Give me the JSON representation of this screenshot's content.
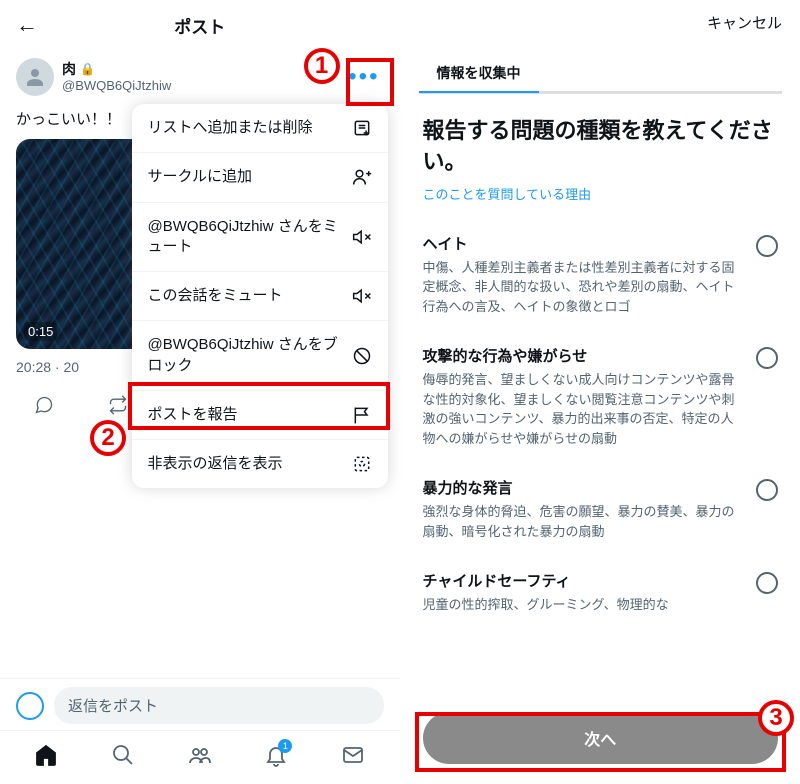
{
  "left": {
    "header_title": "ポスト",
    "user": {
      "name": "肉",
      "handle": "@BWQB6QiJtzhiw"
    },
    "post_text": "かっこいい！！",
    "duration": "0:15",
    "timestamp": "20:28 · 20",
    "reply_placeholder": "返信をポスト",
    "notif_badge": "1",
    "menu": [
      "リストへ追加または削除",
      "サークルに追加",
      "@BWQB6QiJtzhiw さんをミュート",
      "この会話をミュート",
      "@BWQB6QiJtzhiw さんをブロック",
      "ポストを報告",
      "非表示の返信を表示"
    ]
  },
  "right": {
    "cancel": "キャンセル",
    "step": "情報を収集中",
    "title": "報告する問題の種類を教えてください。",
    "reason_link": "このことを質問している理由",
    "next": "次へ",
    "options": [
      {
        "title": "ヘイト",
        "desc": "中傷、人種差別主義者または性差別主義者に対する固定概念、非人間的な扱い、恐れや差別の扇動、ヘイト行為への言及、ヘイトの象徴とロゴ"
      },
      {
        "title": "攻撃的な行為や嫌がらせ",
        "desc": "侮辱的発言、望ましくない成人向けコンテンツや露骨な性的対象化、望ましくない閲覧注意コンテンツや刺激の強いコンテンツ、暴力的出来事の否定、特定の人物への嫌がらせや嫌がらせの扇動"
      },
      {
        "title": "暴力的な発言",
        "desc": "強烈な身体的脅迫、危害の願望、暴力の賛美、暴力の扇動、暗号化された暴力の扇動"
      },
      {
        "title": "チャイルドセーフティ",
        "desc": "児童の性的搾取、グルーミング、物理的な"
      }
    ]
  },
  "callouts": {
    "1": "1",
    "2": "2",
    "3": "3"
  }
}
